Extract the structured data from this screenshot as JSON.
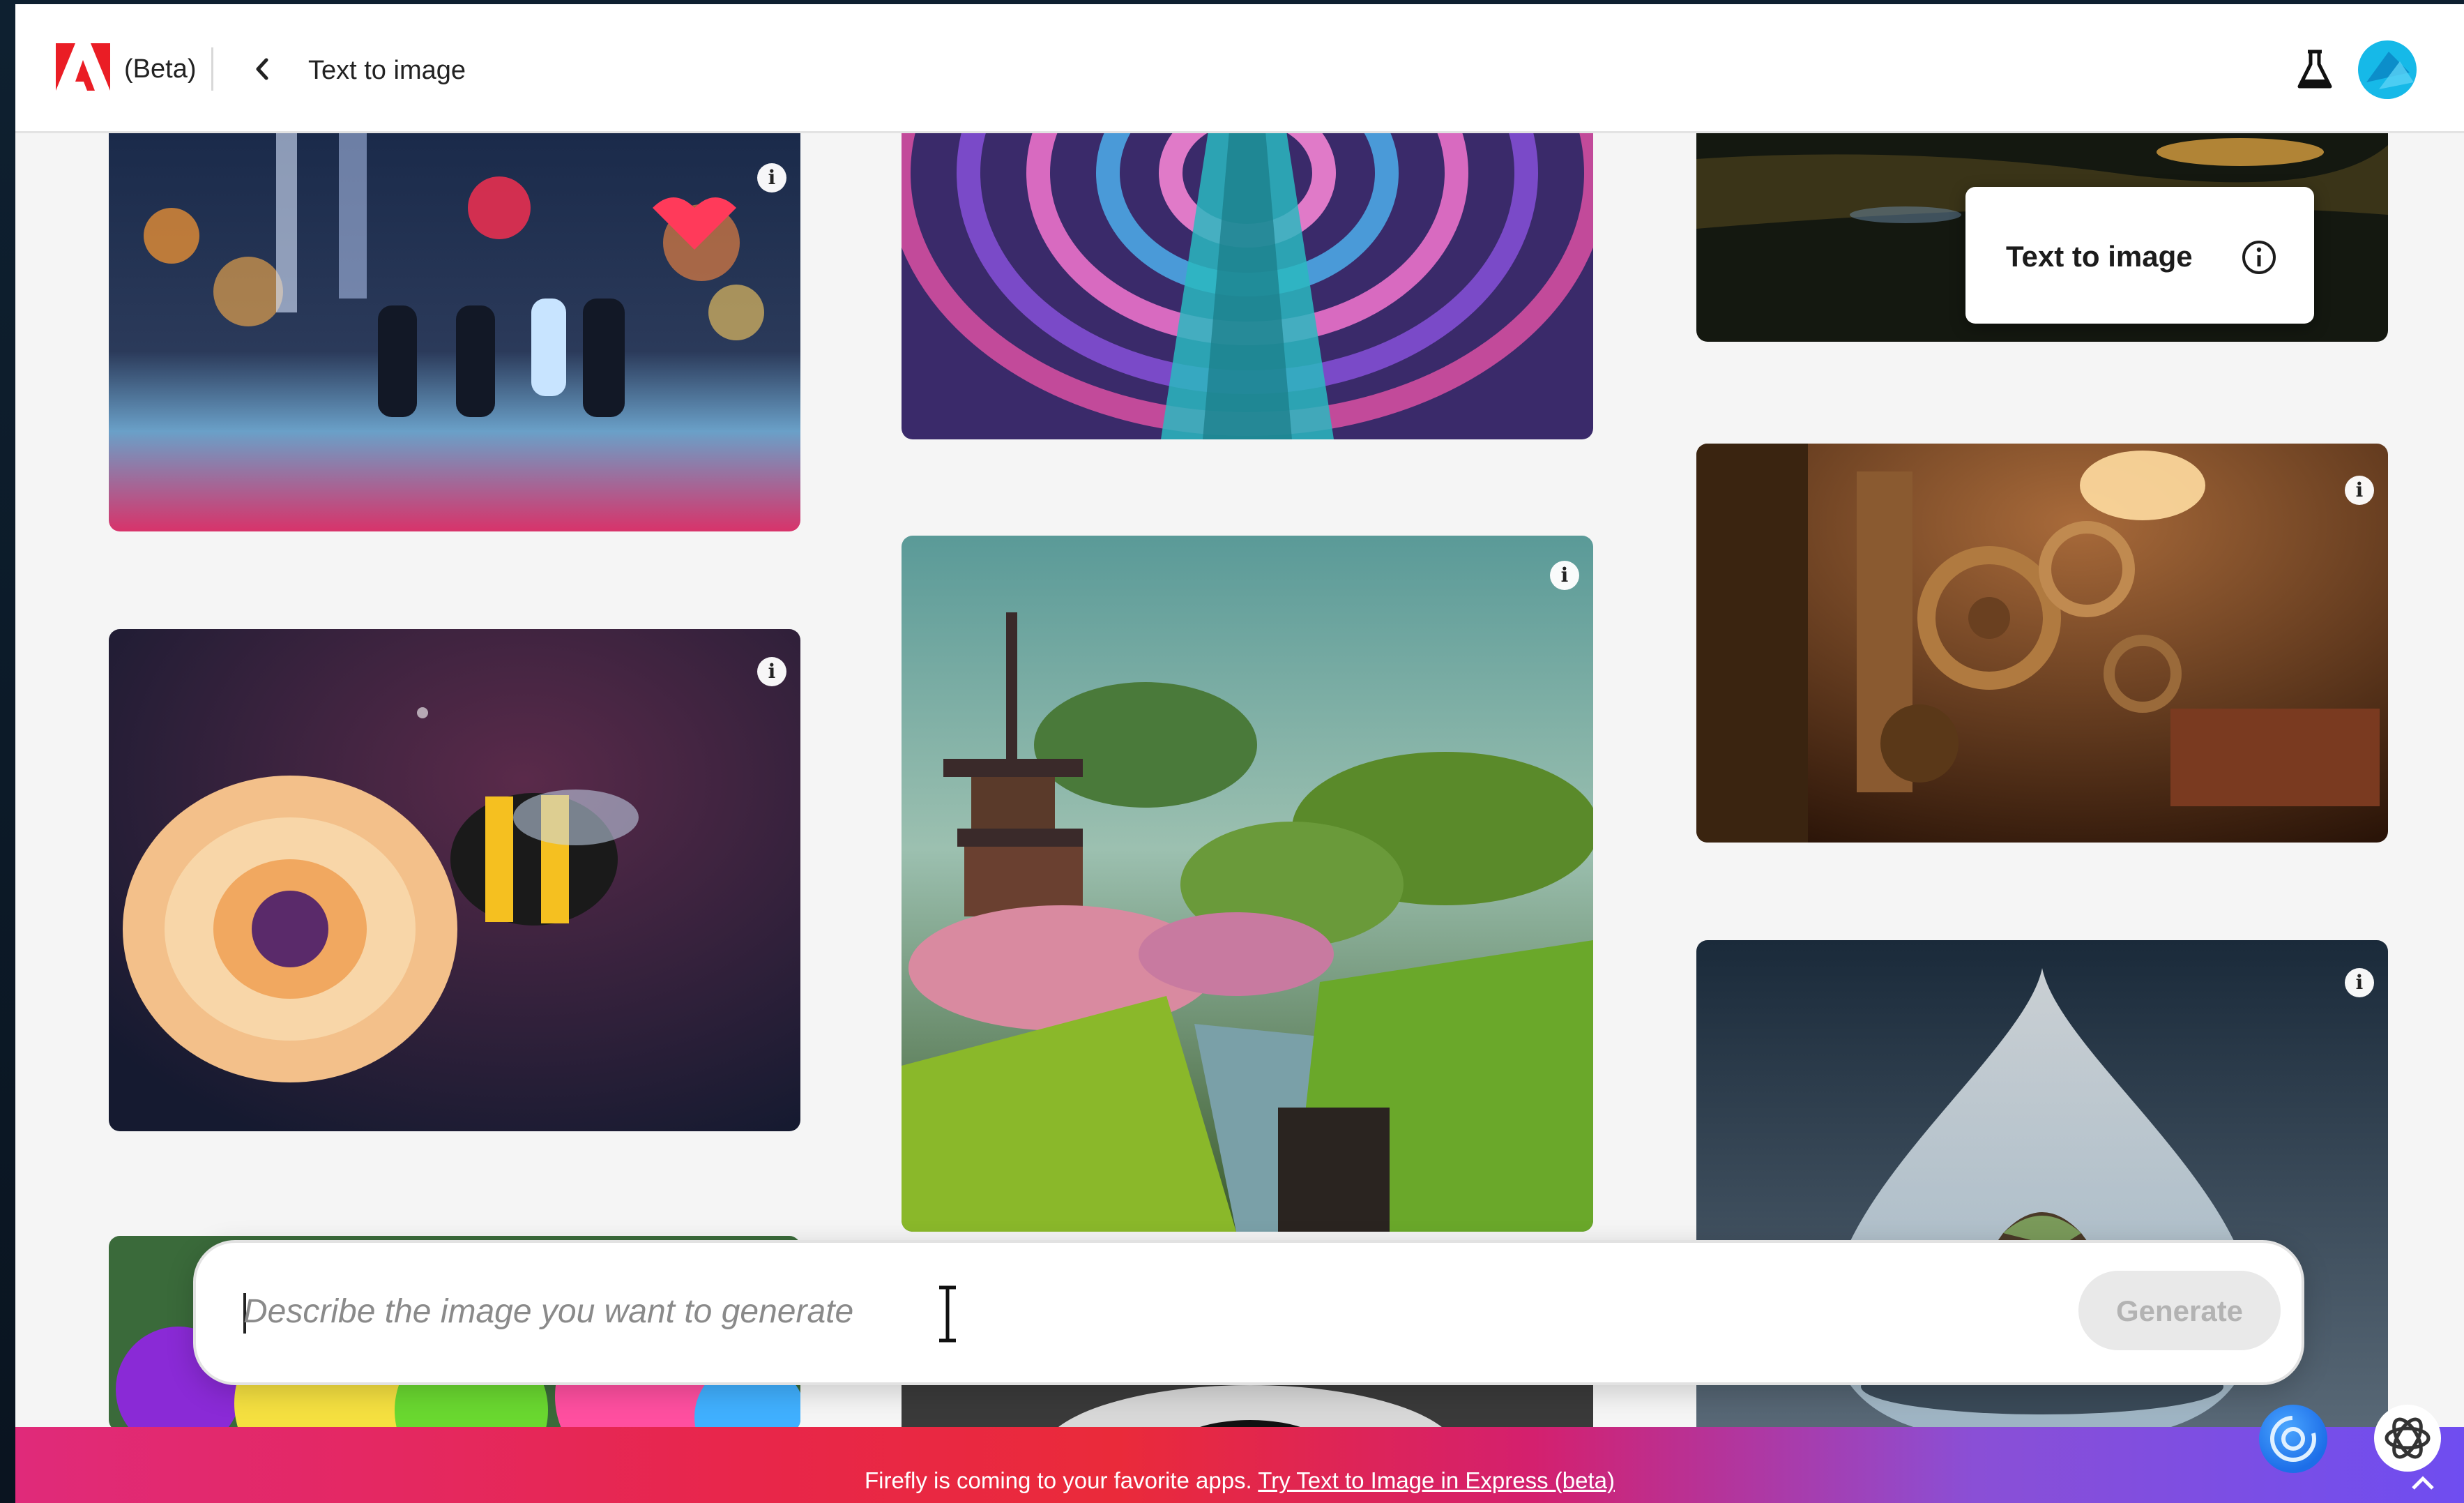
{
  "header": {
    "beta_label": "(Beta)",
    "title": "Text to image",
    "back_icon": "chevron-left-icon",
    "labs_icon": "flask-icon",
    "brand_color": "#ea1d25"
  },
  "tooltip": {
    "label": "Text to image",
    "icon": "info-icon"
  },
  "gallery": {
    "info_glyph": "i",
    "cards": [
      {
        "name": "card-city-couples",
        "subject": "couples walking at night city street"
      },
      {
        "name": "card-psychedelic-tunnel",
        "subject": "psychedelic tunnel"
      },
      {
        "name": "card-dark-landscape",
        "subject": "dark landscape"
      },
      {
        "name": "card-bee-flower",
        "subject": "bee on flower"
      },
      {
        "name": "card-pagoda-landscape",
        "subject": "pagoda landscape"
      },
      {
        "name": "card-steampunk-room",
        "subject": "steampunk room"
      },
      {
        "name": "card-water-drop-mountain",
        "subject": "water drop with mountain"
      },
      {
        "name": "card-colorful-flowers",
        "subject": "colorful flowers"
      },
      {
        "name": "card-monochrome",
        "subject": "monochrome image"
      }
    ]
  },
  "prompt": {
    "placeholder": "Describe the image you want to generate",
    "value": "",
    "generate_label": "Generate"
  },
  "footer": {
    "text": "Firefly is coming to your favorite apps. ",
    "link_text": "Try Text to Image in Express (beta)"
  }
}
